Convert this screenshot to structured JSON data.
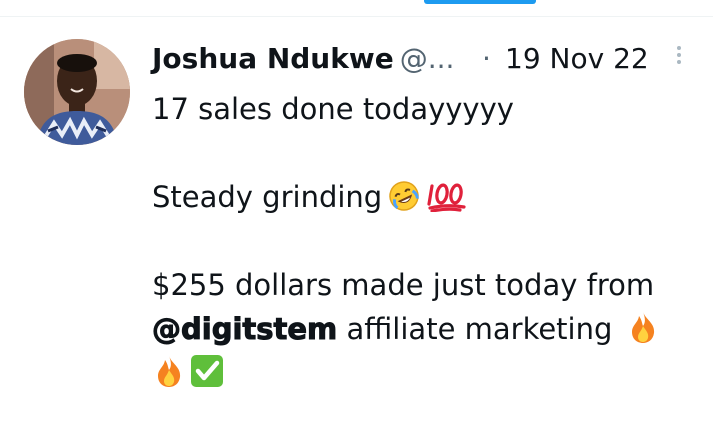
{
  "tweet": {
    "author_name": "Joshua Ndukwe",
    "author_handle": "@...",
    "separator": "·",
    "date": "19 Nov 22",
    "lines": {
      "l1": "17 sales done todayyyyy",
      "l2": "Steady grinding",
      "l3": "$255 dollars made just today from",
      "l4_mention": "@digitstem",
      "l4_rest": "affiliate marketing"
    },
    "icons": {
      "avatar": "profile-photo",
      "more": "more-vertical-icon",
      "emoji_1": "rolling-on-floor-laughing-emoji",
      "emoji_2": "hundred-points-emoji",
      "emoji_3": "fire-emoji",
      "emoji_4": "fire-emoji",
      "emoji_5": "check-mark-button-emoji"
    }
  },
  "colors": {
    "text": "#0f1419",
    "secondary_text": "#536471",
    "accent": "#1d9bf0",
    "divider": "#eff3f4"
  }
}
